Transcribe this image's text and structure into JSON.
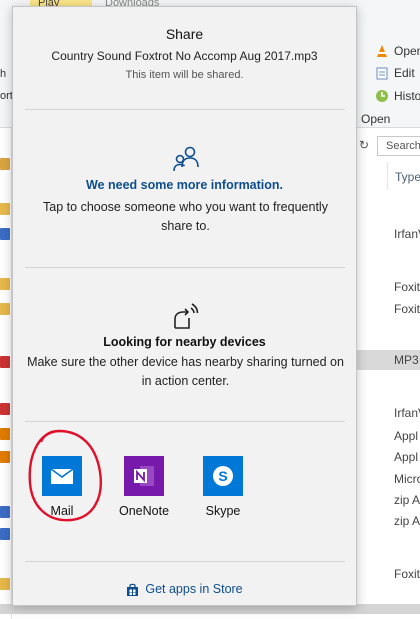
{
  "background": {
    "tabs": [
      "Play",
      "Downloads"
    ],
    "right_menu": [
      "Open",
      "Edit",
      "History",
      "Open"
    ],
    "search_label": "Search",
    "type_header": "Type",
    "left_letters": [
      "h",
      "ort"
    ],
    "type_cells": [
      "IrfanV",
      "Foxit",
      "Foxit",
      "MP3",
      "IrfanV",
      "Appl",
      "Appl",
      "Micro",
      "zip A",
      "zip A",
      "Foxit"
    ]
  },
  "share": {
    "title": "Share",
    "file_name": "Country Sound Foxtrot No Accomp Aug 2017.mp3",
    "subtitle": "This item will be shared.",
    "info_title": "We need some more information.",
    "info_desc": "Tap to choose someone who you want to frequently share to.",
    "nearby_title": "Looking for nearby devices",
    "nearby_desc": "Make sure the other device has nearby sharing turned on in action center.",
    "apps": [
      {
        "label": "Mail",
        "icon": "mail-icon"
      },
      {
        "label": "OneNote",
        "icon": "onenote-icon"
      },
      {
        "label": "Skype",
        "icon": "skype-icon"
      }
    ],
    "store_label": "Get apps in Store"
  },
  "colors": {
    "accent_blue": "#0e4e8e",
    "mail_tile": "#0078d7",
    "onenote_tile": "#7719aa",
    "skype_tile": "#0078d7",
    "annotation_circle": "#e0102a"
  }
}
